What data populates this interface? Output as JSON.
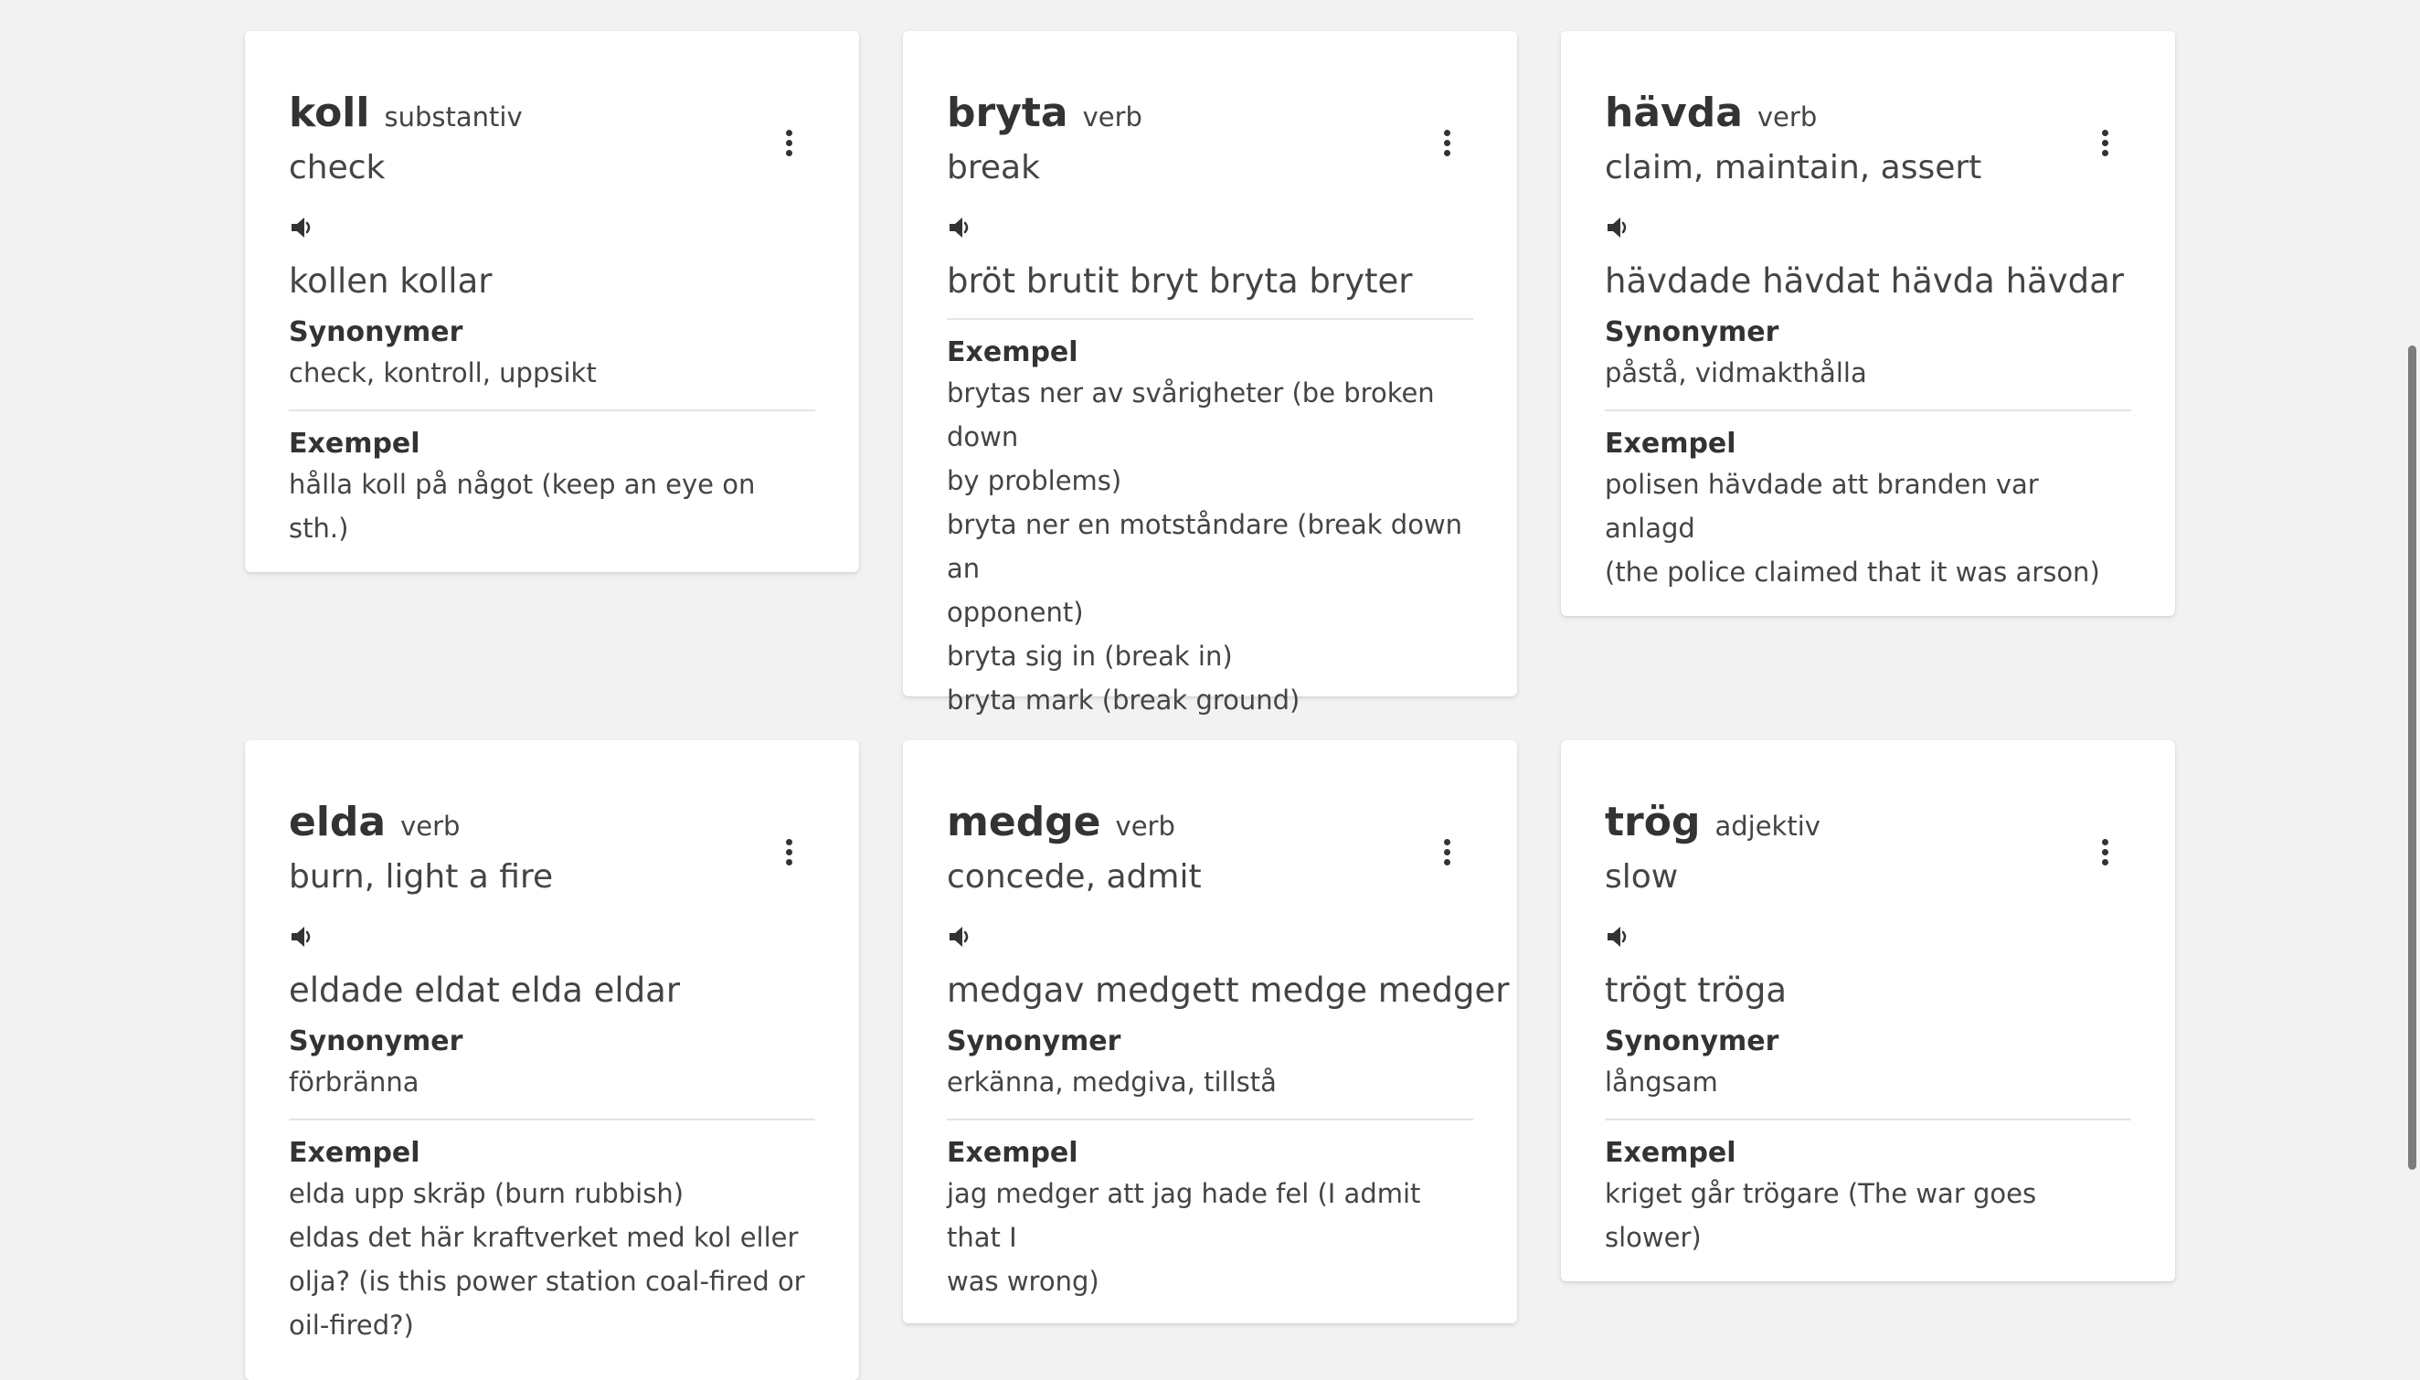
{
  "cards": [
    {
      "word": "koll",
      "pos": "substantiv",
      "translation": "check",
      "forms": "kollen kollar",
      "sections": [
        {
          "label": "Synonymer",
          "lines": [
            "check, kontroll, uppsikt"
          ]
        },
        {
          "label": "Exempel",
          "lines": [
            "hålla koll på något (keep an eye on sth.)"
          ]
        }
      ],
      "speaker_icon": "speaker-icon",
      "menu_icon": "more-vert-icon"
    },
    {
      "word": "bryta",
      "pos": "verb",
      "translation": "break",
      "forms": "bröt brutit bryt bryta bryter",
      "sections": [
        {
          "label": "Exempel",
          "lines": [
            "brytas ner av svårigheter (be broken down",
            "by problems)",
            "bryta ner en motståndare (break down an",
            "opponent)",
            "bryta sig in (break in)",
            "bryta mark (break ground)"
          ]
        }
      ],
      "speaker_icon": "speaker-icon",
      "menu_icon": "more-vert-icon"
    },
    {
      "word": "hävda",
      "pos": "verb",
      "translation": "claim, maintain, assert",
      "forms": "hävdade hävdat hävda hävdar",
      "sections": [
        {
          "label": "Synonymer",
          "lines": [
            "påstå, vidmakthålla"
          ]
        },
        {
          "label": "Exempel",
          "lines": [
            "polisen hävdade att branden var anlagd",
            "(the police claimed that it was arson)"
          ]
        }
      ],
      "speaker_icon": "speaker-icon",
      "menu_icon": "more-vert-icon"
    },
    {
      "word": "elda",
      "pos": "verb",
      "translation": "burn, light a fire",
      "forms": "eldade eldat elda eldar",
      "sections": [
        {
          "label": "Synonymer",
          "lines": [
            "förbränna"
          ]
        },
        {
          "label": "Exempel",
          "lines": [
            "elda upp skräp (burn rubbish)",
            "eldas det här kraftverket med kol eller",
            "olja? (is this power station coal-fired or",
            "oil-fired?)"
          ]
        }
      ],
      "speaker_icon": "speaker-icon",
      "menu_icon": "more-vert-icon"
    },
    {
      "word": "medge",
      "pos": "verb",
      "translation": "concede, admit",
      "forms": "medgav medgett medge medger",
      "sections": [
        {
          "label": "Synonymer",
          "lines": [
            "erkänna, medgiva, tillstå"
          ]
        },
        {
          "label": "Exempel",
          "lines": [
            "jag medger att jag hade fel (I admit that I",
            "was wrong)"
          ]
        }
      ],
      "speaker_icon": "speaker-icon",
      "menu_icon": "more-vert-icon"
    },
    {
      "word": "trög",
      "pos": "adjektiv",
      "translation": "slow",
      "forms": "trögt tröga",
      "sections": [
        {
          "label": "Synonymer",
          "lines": [
            "långsam"
          ]
        },
        {
          "label": "Exempel",
          "lines": [
            "kriget går trögare (The war goes slower)"
          ]
        }
      ],
      "speaker_icon": "speaker-icon",
      "menu_icon": "more-vert-icon"
    }
  ],
  "colors": {
    "background": "#f2f2f2",
    "card": "#ffffff",
    "text": "#333333",
    "divider": "#e4e4e4"
  }
}
